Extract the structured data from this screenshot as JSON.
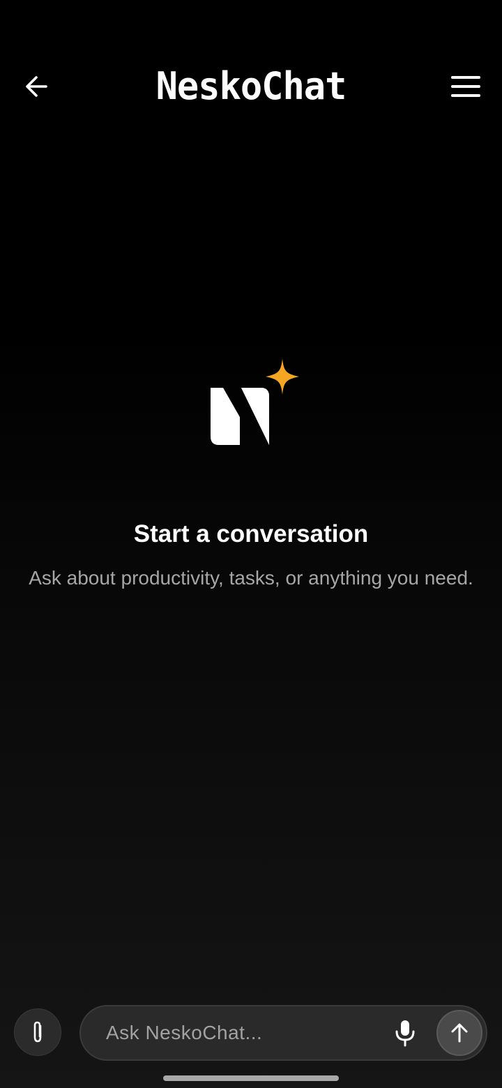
{
  "header": {
    "app_title": "NeskoChat",
    "back_icon": "arrow-left-icon",
    "menu_icon": "hamburger-menu-icon"
  },
  "empty_state": {
    "logo_icon": "nesko-logo-with-sparkle",
    "title": "Start a conversation",
    "subtitle": "Ask about productivity, tasks, or anything you need."
  },
  "composer": {
    "placeholder": "Ask NeskoChat...",
    "value": "",
    "attach_icon": "paperclip-icon",
    "mic_icon": "microphone-icon",
    "send_icon": "arrow-up-icon"
  },
  "colors": {
    "background": "#000000",
    "accent_sparkle": "#F5A623",
    "text_primary": "#FFFFFF",
    "text_secondary": "#A6A6A6",
    "input_background": "#2A2A2A"
  }
}
